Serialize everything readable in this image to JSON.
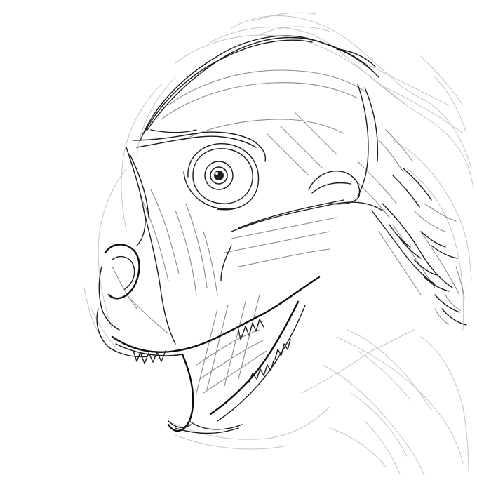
{
  "image": {
    "subject_icon": "dinosaur-head-sketch",
    "palette": {
      "background": "#ffffff",
      "ink_dark": "#1c1c1c",
      "ink_mid": "#8a8a8a",
      "ink_light": "#c4c4c4"
    }
  }
}
